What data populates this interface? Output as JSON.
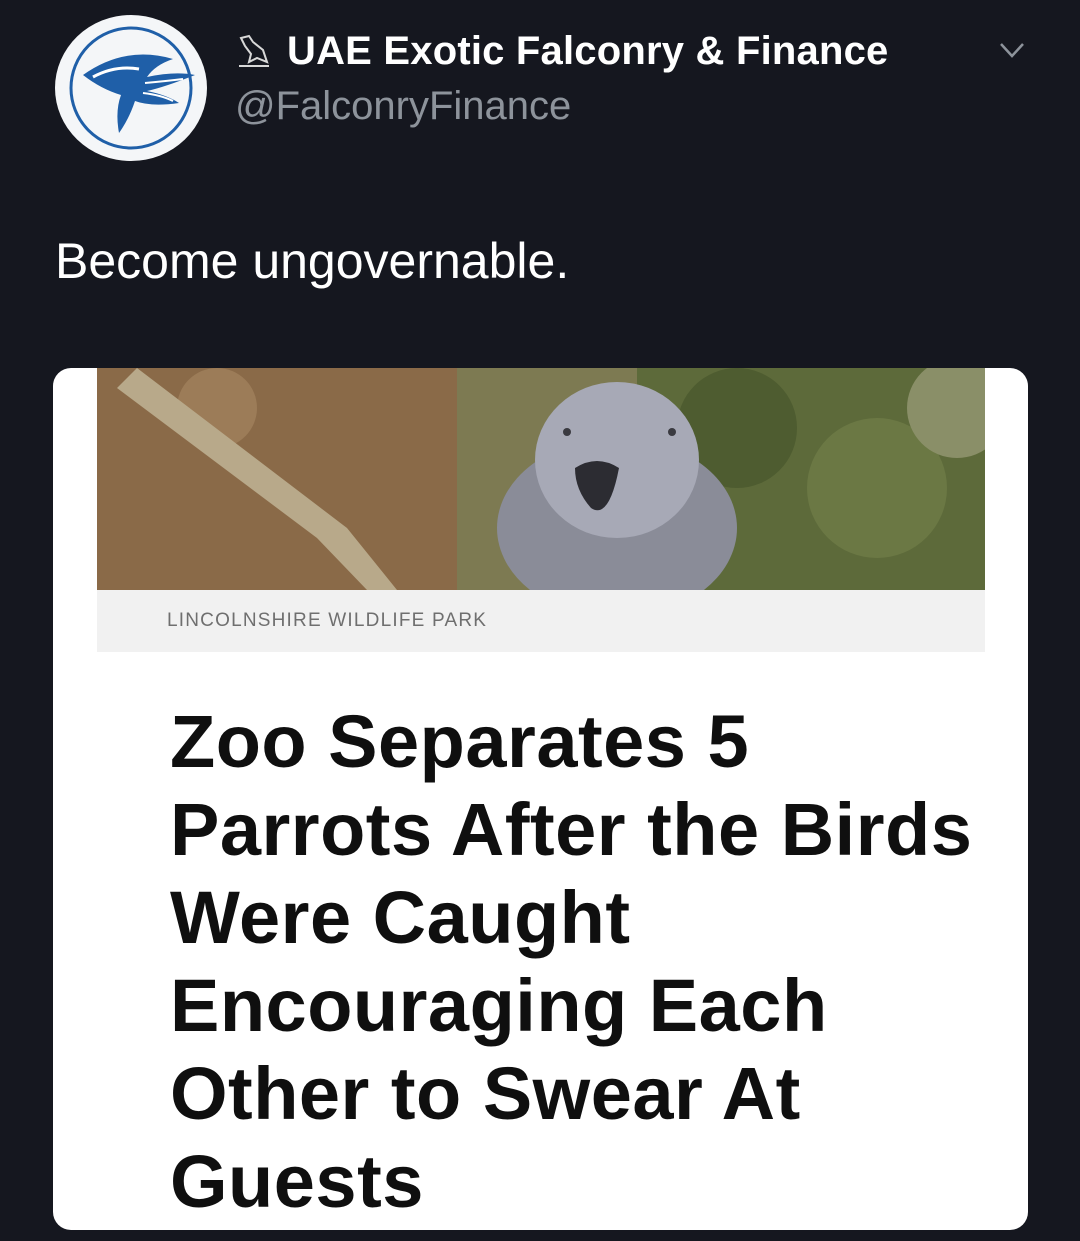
{
  "tweet": {
    "display_name": "UAE Exotic Falconry & Finance",
    "handle": "@FalconryFinance",
    "text": "Become ungovernable.",
    "icons": {
      "avatar": "falcon-logo-avatar",
      "name_badge": "falcon-icon",
      "menu": "chevron-down-icon"
    }
  },
  "card": {
    "image_subject": "african-grey-parrot-photo",
    "image_credit": "LINCOLNSHIRE WILDLIFE PARK",
    "headline": "Zoo Separates 5 Parrots After the Birds Were Caught Encouraging Each Other to Swear At Guests"
  },
  "colors": {
    "background": "#15171f",
    "text_primary": "#ffffff",
    "text_secondary": "#8d939b",
    "card_background": "#ffffff",
    "logo_blue": "#1f5fa8"
  }
}
